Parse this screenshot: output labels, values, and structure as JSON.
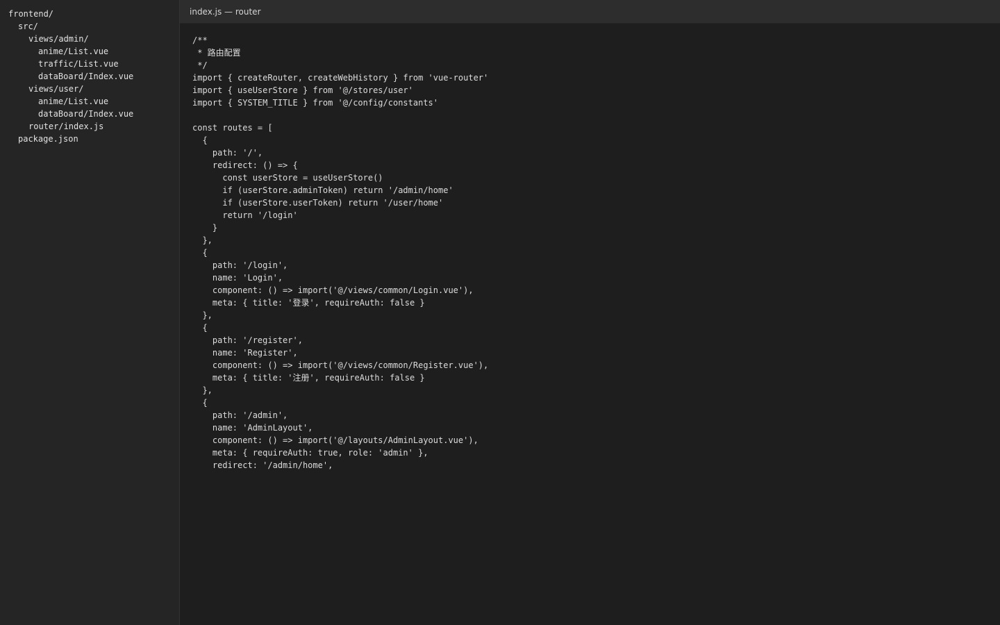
{
  "sidebar": {
    "items": [
      {
        "label": "frontend/",
        "depth": 0
      },
      {
        "label": "src/",
        "depth": 1
      },
      {
        "label": "views/admin/",
        "depth": 2
      },
      {
        "label": "anime/List.vue",
        "depth": 3
      },
      {
        "label": "traffic/List.vue",
        "depth": 3
      },
      {
        "label": "dataBoard/Index.vue",
        "depth": 3
      },
      {
        "label": "views/user/",
        "depth": 2
      },
      {
        "label": "anime/List.vue",
        "depth": 3
      },
      {
        "label": "dataBoard/Index.vue",
        "depth": 3
      },
      {
        "label": "router/index.js",
        "depth": 2
      },
      {
        "label": "package.json",
        "depth": 1
      }
    ]
  },
  "tab": {
    "title": "index.js — router"
  },
  "editor": {
    "lines": [
      "/**",
      " * 路由配置",
      " */",
      "import { createRouter, createWebHistory } from 'vue-router'",
      "import { useUserStore } from '@/stores/user'",
      "import { SYSTEM_TITLE } from '@/config/constants'",
      "",
      "const routes = [",
      "  {",
      "    path: '/',",
      "    redirect: () => {",
      "      const userStore = useUserStore()",
      "      if (userStore.adminToken) return '/admin/home'",
      "      if (userStore.userToken) return '/user/home'",
      "      return '/login'",
      "    }",
      "  },",
      "  {",
      "    path: '/login',",
      "    name: 'Login',",
      "    component: () => import('@/views/common/Login.vue'),",
      "    meta: { title: '登录', requireAuth: false }",
      "  },",
      "  {",
      "    path: '/register',",
      "    name: 'Register',",
      "    component: () => import('@/views/common/Register.vue'),",
      "    meta: { title: '注册', requireAuth: false }",
      "  },",
      "  {",
      "    path: '/admin',",
      "    name: 'AdminLayout',",
      "    component: () => import('@/layouts/AdminLayout.vue'),",
      "    meta: { requireAuth: true, role: 'admin' },",
      "    redirect: '/admin/home',"
    ]
  },
  "colors": {
    "sidebar_bg": "#252526",
    "editor_bg": "#1e1e1e",
    "tab_bar_bg": "#2d2d2d",
    "text": "#dcdcdc"
  }
}
